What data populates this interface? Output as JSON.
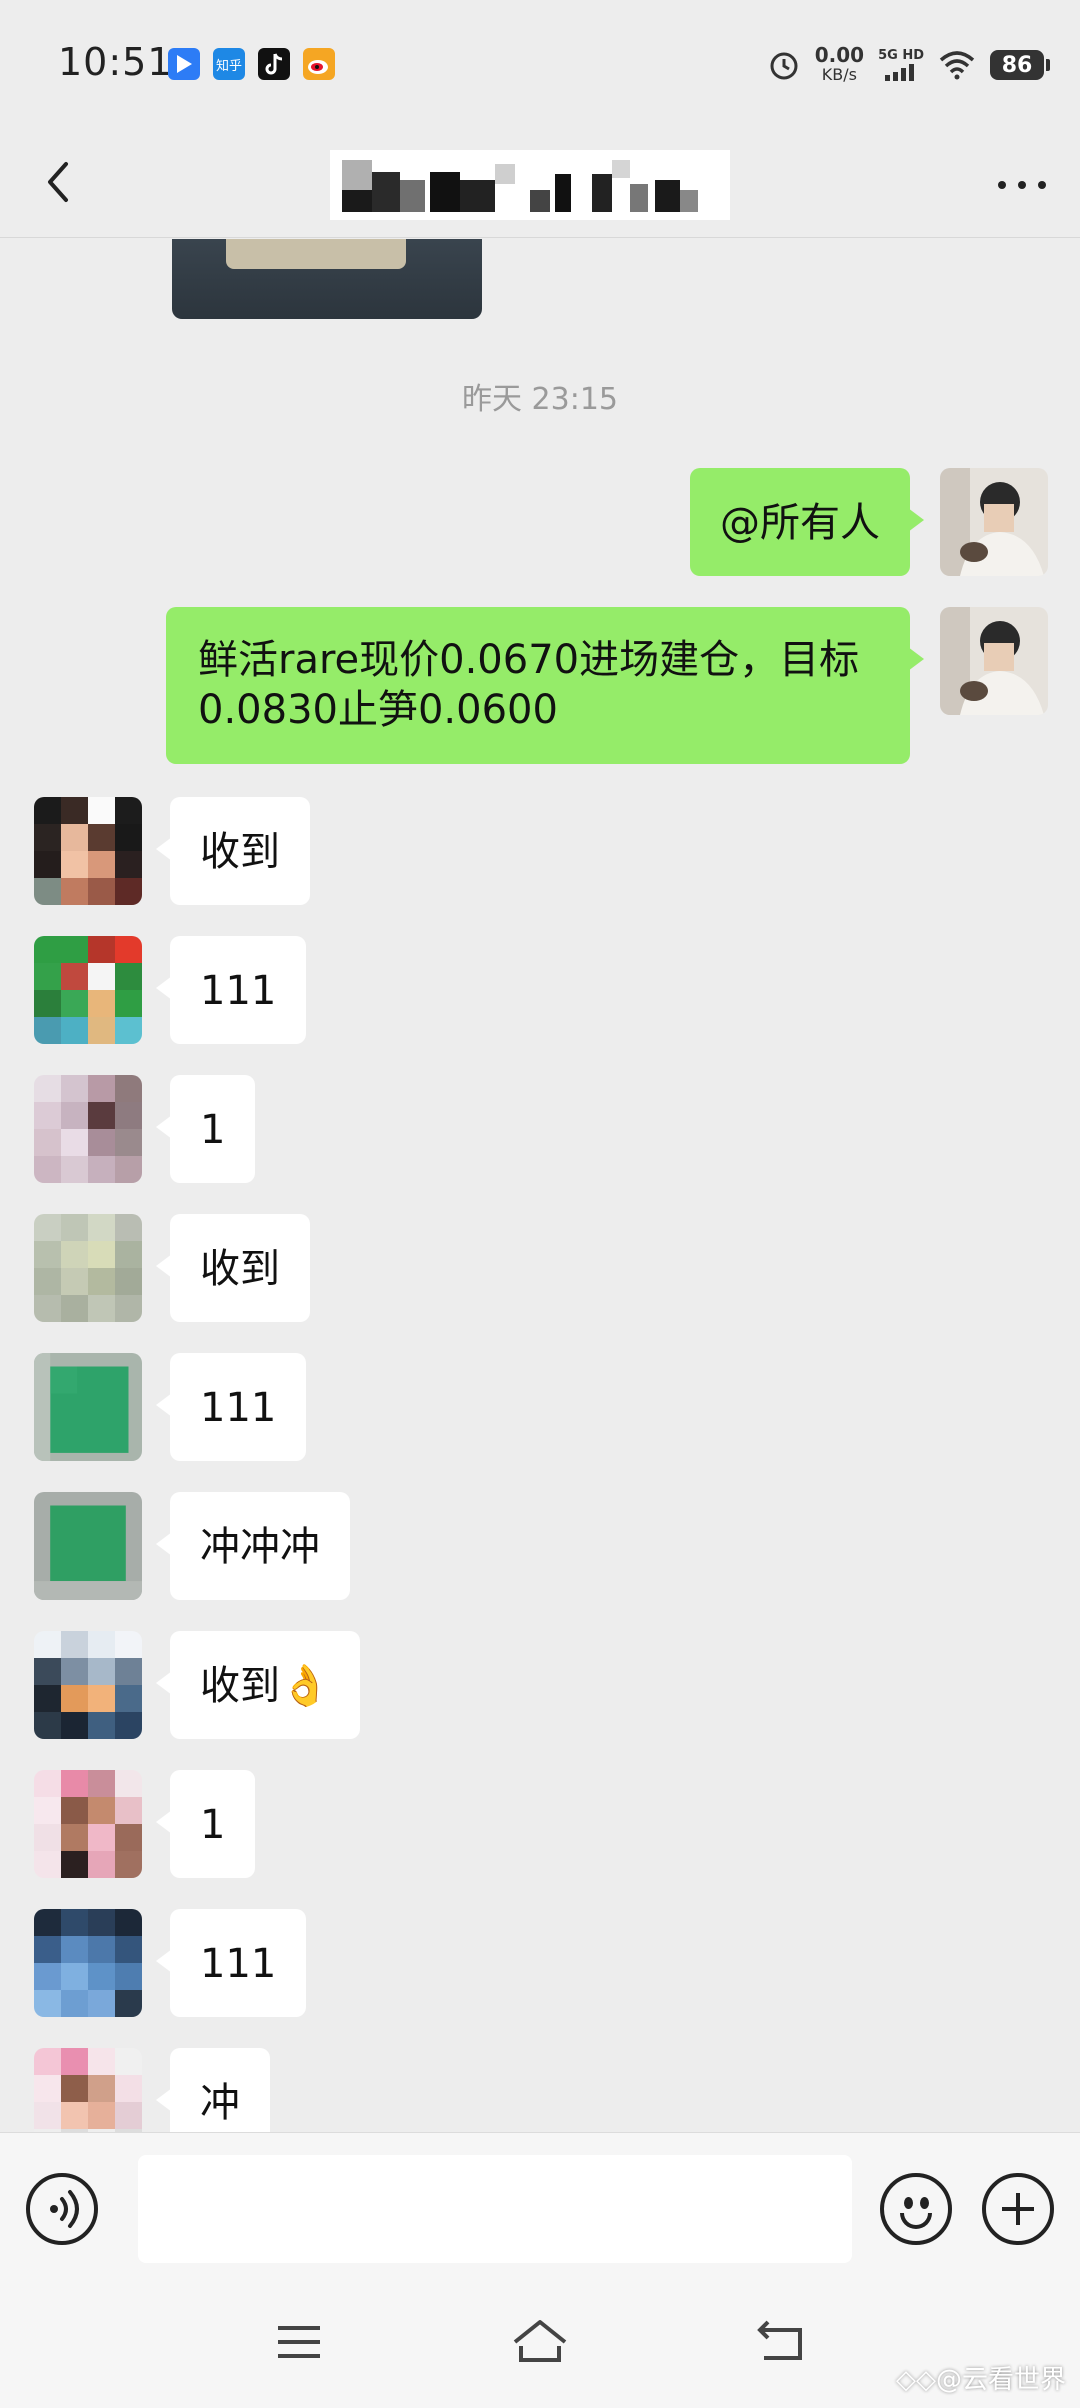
{
  "status_bar": {
    "time": "10:51",
    "app_icons": [
      {
        "name": "feishu-icon",
        "color": "#2d7cf6"
      },
      {
        "name": "zhihu-icon",
        "color": "#1e88e5",
        "text": "知乎"
      },
      {
        "name": "tiktok-icon",
        "color": "#111111"
      },
      {
        "name": "weibo-icon",
        "color": "#f5a623"
      }
    ],
    "net_speed_value": "0.00",
    "net_speed_unit": "KB/s",
    "network_label": "5G HD",
    "battery": "86"
  },
  "nav": {
    "title": ""
  },
  "chat": {
    "timestamp": "昨天 23:15",
    "my_messages": [
      {
        "text": "@所有人"
      },
      {
        "text": "鲜活rare现价0.0670进场建仓，目标0.0830止笋0.0600"
      }
    ],
    "replies": [
      {
        "text": "收到"
      },
      {
        "text": "111"
      },
      {
        "text": "1"
      },
      {
        "text": "收到"
      },
      {
        "text": "111"
      },
      {
        "text": "冲冲冲"
      },
      {
        "text": "收到👌"
      },
      {
        "text": "1"
      },
      {
        "text": "111"
      },
      {
        "text": "冲"
      }
    ]
  },
  "input_bar": {
    "placeholder": ""
  },
  "watermark": "◇◇@云看世界"
}
